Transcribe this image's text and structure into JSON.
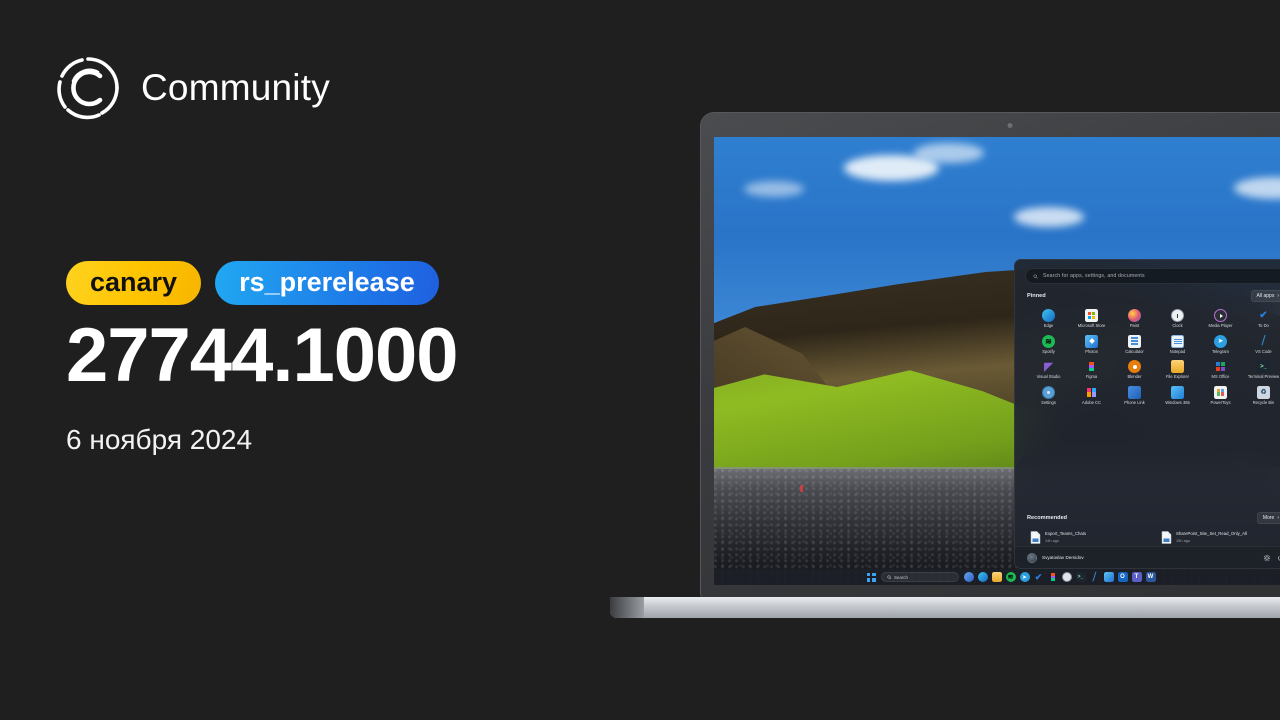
{
  "brand": {
    "name": "Community",
    "logo_icon": "community-c-logo"
  },
  "release": {
    "channel_badge": "canary",
    "branch_badge": "rs_prerelease",
    "build_number": "27744.1000",
    "date": "6 ноября 2024",
    "colors": {
      "canary": "#ffc400",
      "branch": "#1e7ce8",
      "background": "#1f1f1f"
    }
  },
  "start_menu": {
    "search_placeholder": "Search for apps, settings, and documents",
    "search_icon": "search-icon",
    "pinned_title": "Pinned",
    "all_apps_label": "All apps",
    "all_apps_icon": "chevron-right-icon",
    "recommended_title": "Recommended",
    "more_label": "More",
    "more_icon": "chevron-right-icon",
    "pinned": [
      {
        "label": "Edge",
        "icon": "edge-icon"
      },
      {
        "label": "Microsoft Store",
        "icon": "microsoft-store-icon"
      },
      {
        "label": "Paint",
        "icon": "paint-icon"
      },
      {
        "label": "Clock",
        "icon": "clock-icon"
      },
      {
        "label": "Media Player",
        "icon": "media-player-icon"
      },
      {
        "label": "To Do",
        "icon": "to-do-icon"
      },
      {
        "label": "Spotify",
        "icon": "spotify-icon"
      },
      {
        "label": "Photos",
        "icon": "photos-icon"
      },
      {
        "label": "Calculator",
        "icon": "calculator-icon"
      },
      {
        "label": "Notepad",
        "icon": "notepad-icon"
      },
      {
        "label": "Telegram",
        "icon": "telegram-icon"
      },
      {
        "label": "VS Code",
        "icon": "vs-code-icon"
      },
      {
        "label": "Visual Studio",
        "icon": "visual-studio-icon"
      },
      {
        "label": "Figma",
        "icon": "figma-icon"
      },
      {
        "label": "Blender",
        "icon": "blender-icon"
      },
      {
        "label": "File Explorer",
        "icon": "file-explorer-icon"
      },
      {
        "label": "MS Office",
        "icon": "ms-office-icon"
      },
      {
        "label": "Terminal Preview",
        "icon": "terminal-preview-icon"
      },
      {
        "label": "Settings",
        "icon": "settings-gear-icon"
      },
      {
        "label": "Adobe CC",
        "icon": "adobe-cc-icon"
      },
      {
        "label": "Phone Link",
        "icon": "phone-link-icon"
      },
      {
        "label": "Windows 365",
        "icon": "windows-365-icon"
      },
      {
        "label": "PowerToys",
        "icon": "powertoys-icon"
      },
      {
        "label": "Recycle Bin",
        "icon": "recycle-bin-icon"
      }
    ],
    "recommended": [
      {
        "title": "Export_Teams_Chats",
        "subtitle": "14h ago",
        "icon": "document-icon"
      },
      {
        "title": "SharePoint_Site_Set_Read_Only_All",
        "subtitle": "15h ago",
        "icon": "document-icon"
      }
    ],
    "account": {
      "user_name": "Svyatoslav Demidov",
      "avatar_icon": "avatar-icon",
      "settings_icon": "gear-icon",
      "power_icon": "power-icon"
    }
  },
  "taskbar": {
    "start_icon": "windows-start-icon",
    "search_placeholder": "Search",
    "search_icon": "search-icon",
    "items": [
      {
        "name": "copilot-icon",
        "color": "#3c6fd4"
      },
      {
        "name": "edge-icon",
        "color": "#2d9fd9"
      },
      {
        "name": "file-explorer-icon",
        "color": "#e8b33c"
      },
      {
        "name": "spotify-icon",
        "color": "#1db954"
      },
      {
        "name": "telegram-icon",
        "color": "#2aa0e0"
      },
      {
        "name": "to-do-icon",
        "color": "#2d7fe0"
      },
      {
        "name": "figma-icon",
        "color": "#e2483d"
      },
      {
        "name": "clock-icon",
        "color": "#4a5a6d"
      },
      {
        "name": "terminal-icon",
        "color": "#1f2b35"
      },
      {
        "name": "vs-code-icon",
        "color": "#2b7cc4"
      },
      {
        "name": "photos-icon",
        "color": "#2f8fd6"
      },
      {
        "name": "outlook-icon",
        "color": "#1566c0"
      },
      {
        "name": "teams-icon",
        "color": "#5b5fc7"
      },
      {
        "name": "word-icon",
        "color": "#2b579a"
      }
    ]
  },
  "wallpaper": {
    "description": "cliff-with-green-moss-and-black-pebble-beach",
    "colors": {
      "sky": "#2f7fd0",
      "grass": "#8fbb22",
      "rock": "#3c3227",
      "beach": "#33353a"
    }
  }
}
